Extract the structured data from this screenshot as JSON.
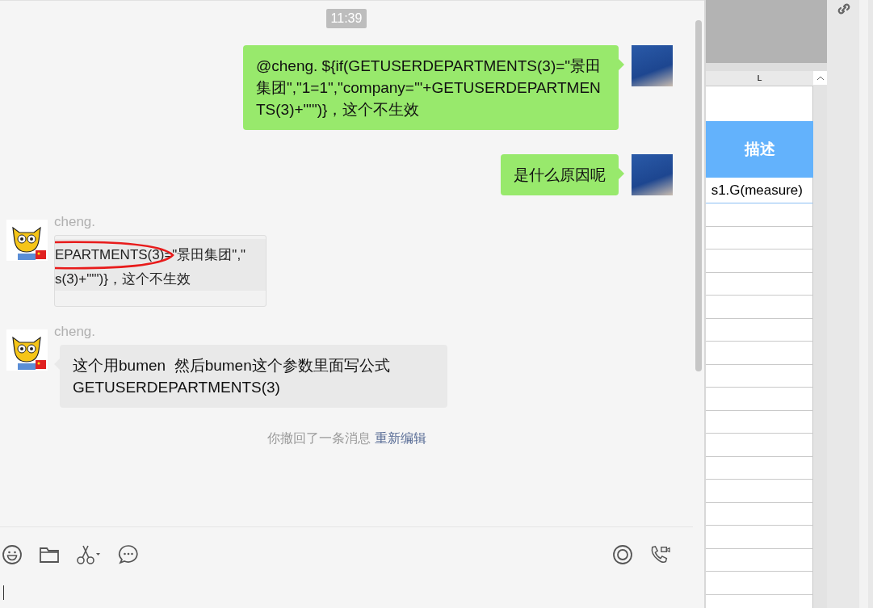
{
  "chat": {
    "messages": [
      {
        "kind": "time",
        "text": "11:39"
      },
      {
        "kind": "sent",
        "text": "@cheng. ${if(GETUSERDEPARTMENTS(3)=\"景田集团\",\"1=1\",\"company='\"+GETUSERDEPARTMENTS(3)+\"'\")}，这个不生效"
      },
      {
        "kind": "sent",
        "text": "是什么原因呢"
      },
      {
        "kind": "received_image",
        "sender": "cheng.",
        "lines": [
          "EPARTMENTS(3)=\"景田集团\",\"",
          "s(3)+\"'\")}，这个不生效"
        ]
      },
      {
        "kind": "received",
        "sender": "cheng.",
        "text": "这个用bumen  然后bumen这个参数里面写公式GETUSERDEPARTMENTS(3)"
      },
      {
        "kind": "recall",
        "text": "你撤回了一条消息",
        "link": "重新编辑"
      }
    ]
  },
  "sheet": {
    "column": "L",
    "header": "描述",
    "cell": "s1.G(measure)"
  }
}
